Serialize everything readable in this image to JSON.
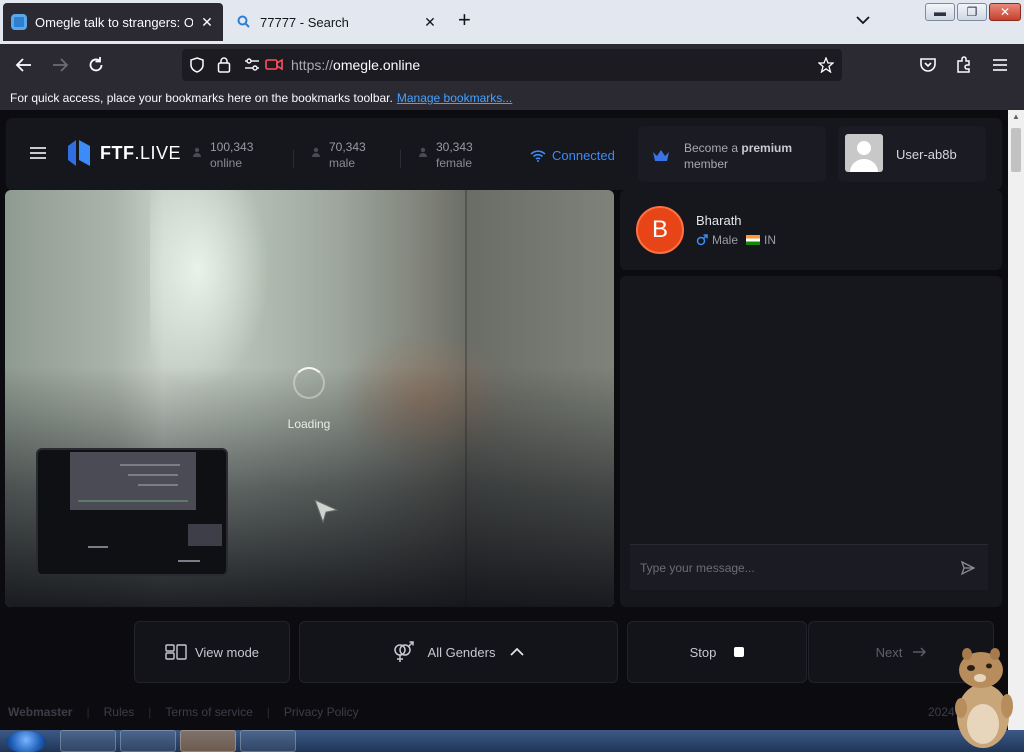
{
  "browser": {
    "tabs": [
      {
        "title": "Omegle talk to strangers: Omegle"
      },
      {
        "title": "77777 - Search"
      }
    ],
    "url_scheme": "https://",
    "url_host": "omegle.online",
    "bookmarks_prompt": "For quick access, place your bookmarks here on the bookmarks toolbar.",
    "bookmarks_link": "Manage bookmarks..."
  },
  "header": {
    "logo_bold": "FTF",
    "logo_rest": ".LIVE",
    "stats": [
      {
        "value": "100,343",
        "label": "online"
      },
      {
        "value": "70,343",
        "label": "male"
      },
      {
        "value": "30,343",
        "label": "female"
      }
    ],
    "connection_status": "Connected",
    "premium_prefix": "Become a",
    "premium_bold": "premium",
    "premium_suffix": "member",
    "username": "User-ab8b"
  },
  "video": {
    "loading_text": "Loading"
  },
  "partner": {
    "initial": "B",
    "name": "Bharath",
    "gender": "Male",
    "country": "IN"
  },
  "chat": {
    "placeholder": "Type your message..."
  },
  "controls": {
    "view_mode": "View mode",
    "gender_filter": "All Genders",
    "stop": "Stop",
    "next": "Next"
  },
  "footer": {
    "links": [
      "Webmaster",
      "Rules",
      "Terms of service",
      "Privacy Policy"
    ],
    "year": "2024"
  },
  "colors": {
    "accent_blue": "#3b8cf6",
    "avatar_orange": "#e74517",
    "page_bg": "#0c0c10",
    "panel_bg": "#16161d"
  },
  "icons": [
    "hamburger-icon",
    "logo-icon",
    "user-icon",
    "wifi-icon",
    "crown-icon",
    "avatar-icon",
    "male-icon",
    "india-flag-icon",
    "send-icon",
    "view-mode-icon",
    "gender-icon",
    "chevron-up-icon",
    "stop-icon",
    "arrow-right-icon"
  ]
}
